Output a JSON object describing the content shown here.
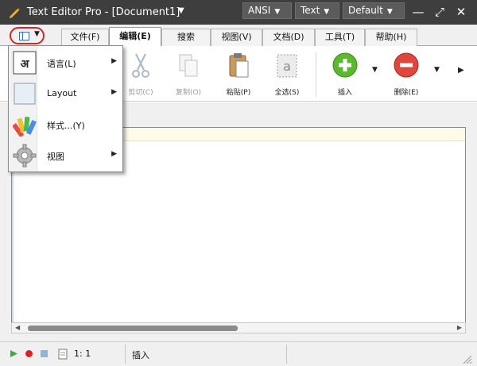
{
  "titlebar": {
    "title": "Text Editor Pro  - [Document1]",
    "encoding": "ANSI",
    "syntax": "Text",
    "theme": "Default",
    "colors": {
      "bg": "#3e3e3e",
      "dropdown_bg": "#5b5b5b"
    }
  },
  "window_buttons": {
    "minimize": "—",
    "maximize": "⤢",
    "close": "✕"
  },
  "tabs": [
    "文件(F)",
    "编辑(E)",
    "搜索",
    "视图(V)",
    "文档(D)",
    "工具(T)",
    "帮助(H)"
  ],
  "active_tab": "编辑(E)",
  "ribbon": {
    "cut": "剪切(C)",
    "copy": "复制(O)",
    "paste": "粘贴(P)",
    "select_all": "全选(S)",
    "insert": "插入",
    "delete": "删除(E)"
  },
  "menu": {
    "items": [
      {
        "label": "语言(L)",
        "icon": "language-icon",
        "submenu": true
      },
      {
        "label": "Layout",
        "icon": "layout-icon",
        "submenu": true
      },
      {
        "label": "样式...(Y)",
        "icon": "palette-icon",
        "submenu": false
      },
      {
        "label": "视图",
        "icon": "gear-icon",
        "submenu": true
      }
    ]
  },
  "status": {
    "position": "1: 1",
    "mode": "插入"
  },
  "colors": {
    "highlight": "#e02020",
    "current_line": "#fffbe6",
    "insert_green": "#5cb82e",
    "delete_red": "#e0463c"
  }
}
